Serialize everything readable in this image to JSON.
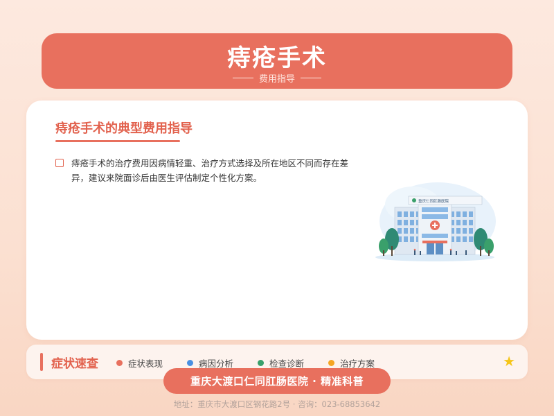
{
  "header": {
    "title": "痔疮手术",
    "subtitle": "费用指导"
  },
  "card": {
    "title": "痔疮手术的典型费用指导",
    "text": "痔疮手术的治疗费用因病情轻重、治疗方式选择及所在地区不同而存在差异，建议来院面诊后由医生评估制定个性化方案。",
    "hospital_sign": "重庆仁同肛肠医院"
  },
  "quick": {
    "title": "症状速查",
    "items": [
      {
        "label": "症状表现",
        "color": "#e8705e"
      },
      {
        "label": "病因分析",
        "color": "#4a90e2"
      },
      {
        "label": "检查诊断",
        "color": "#3aa06b"
      },
      {
        "label": "治疗方案",
        "color": "#f5a623"
      }
    ]
  },
  "brand": {
    "pill": "重庆大渡口仁同肛肠医院 · 精准科普"
  },
  "footer": {
    "address": "地址：重庆市大渡口区钢花路2号 · 咨询：023-68853642"
  },
  "colors": {
    "accent": "#e8705e",
    "star": "#f5c518"
  }
}
